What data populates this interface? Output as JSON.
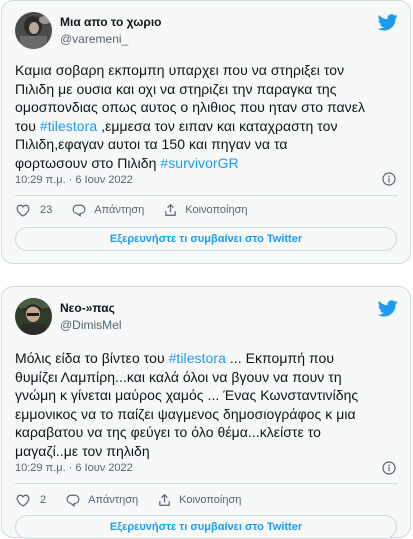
{
  "colors": {
    "accent": "#1d9bf0",
    "text": "#0f1419",
    "muted": "#536471",
    "border": "#cfd9de",
    "card": "#f7f9f9"
  },
  "tweets": [
    {
      "display_name": "Μια απο το χωριο",
      "handle": "@varemeni_",
      "avatar_icon": "profile-photo",
      "brand_icon": "twitter-bird-icon",
      "lines": [
        "Καμια σοβαρη εκπομπη υπαρχει που να στηριξει τον",
        "Πιλιδη με ουσια και οχι να στηριζει την παραγκα της",
        "ομοσπονδιας οπως αυτος ο ηλιθιος που ηταν στο πανελ"
      ],
      "line4_a": "του ",
      "line4_hashtag": "#tilestora",
      "line4_b": " ,εμμεσα τον ειπαν και καταχραστη τον",
      "line5": "Πιλιδη,εφαγαν αυτοι τα 150 και πηγαν να τα",
      "line6_a": "φορτωσουν στο Πιλιδη ",
      "line6_hashtag": "#survivorGR",
      "timestamp": "10:29 π.μ. · 6 Ιουν 2022",
      "likes": "23",
      "reply_label": "Απάντηση",
      "share_label": "Κοινοποίηση",
      "explore_label": "Εξερευνήστε τι συμβαίνει στο Twitter"
    },
    {
      "display_name": "Νεο-»πας",
      "handle": "@DimisMel",
      "avatar_icon": "profile-photo",
      "brand_icon": "twitter-bird-icon",
      "line1_a": "Μόλις είδα το βίντεο του ",
      "line1_hashtag": "#tilestora",
      "line1_b": " ... Εκπομπή που",
      "lines": [
        "θυμίζει Λαμπίρη...και καλά όλοι να βγουν να πουν τη",
        "γνώμη κ γίνεται μαύρος χαμός ... Ένας Κωνσταντινίδης",
        "εμμονικος να το παίζει ψαγμενος δημοσιογράφος κ μια",
        "καραβατου να της φεύγει το όλο θέμα...κλείστε το",
        "μαγαζί..με τον πηλιδη"
      ],
      "timestamp": "10:29 π.μ. · 6 Ιουν 2022",
      "likes": "2",
      "reply_label": "Απάντηση",
      "share_label": "Κοινοποίηση",
      "explore_label": "Εξερευνήστε τι συμβαίνει στο Twitter"
    }
  ]
}
